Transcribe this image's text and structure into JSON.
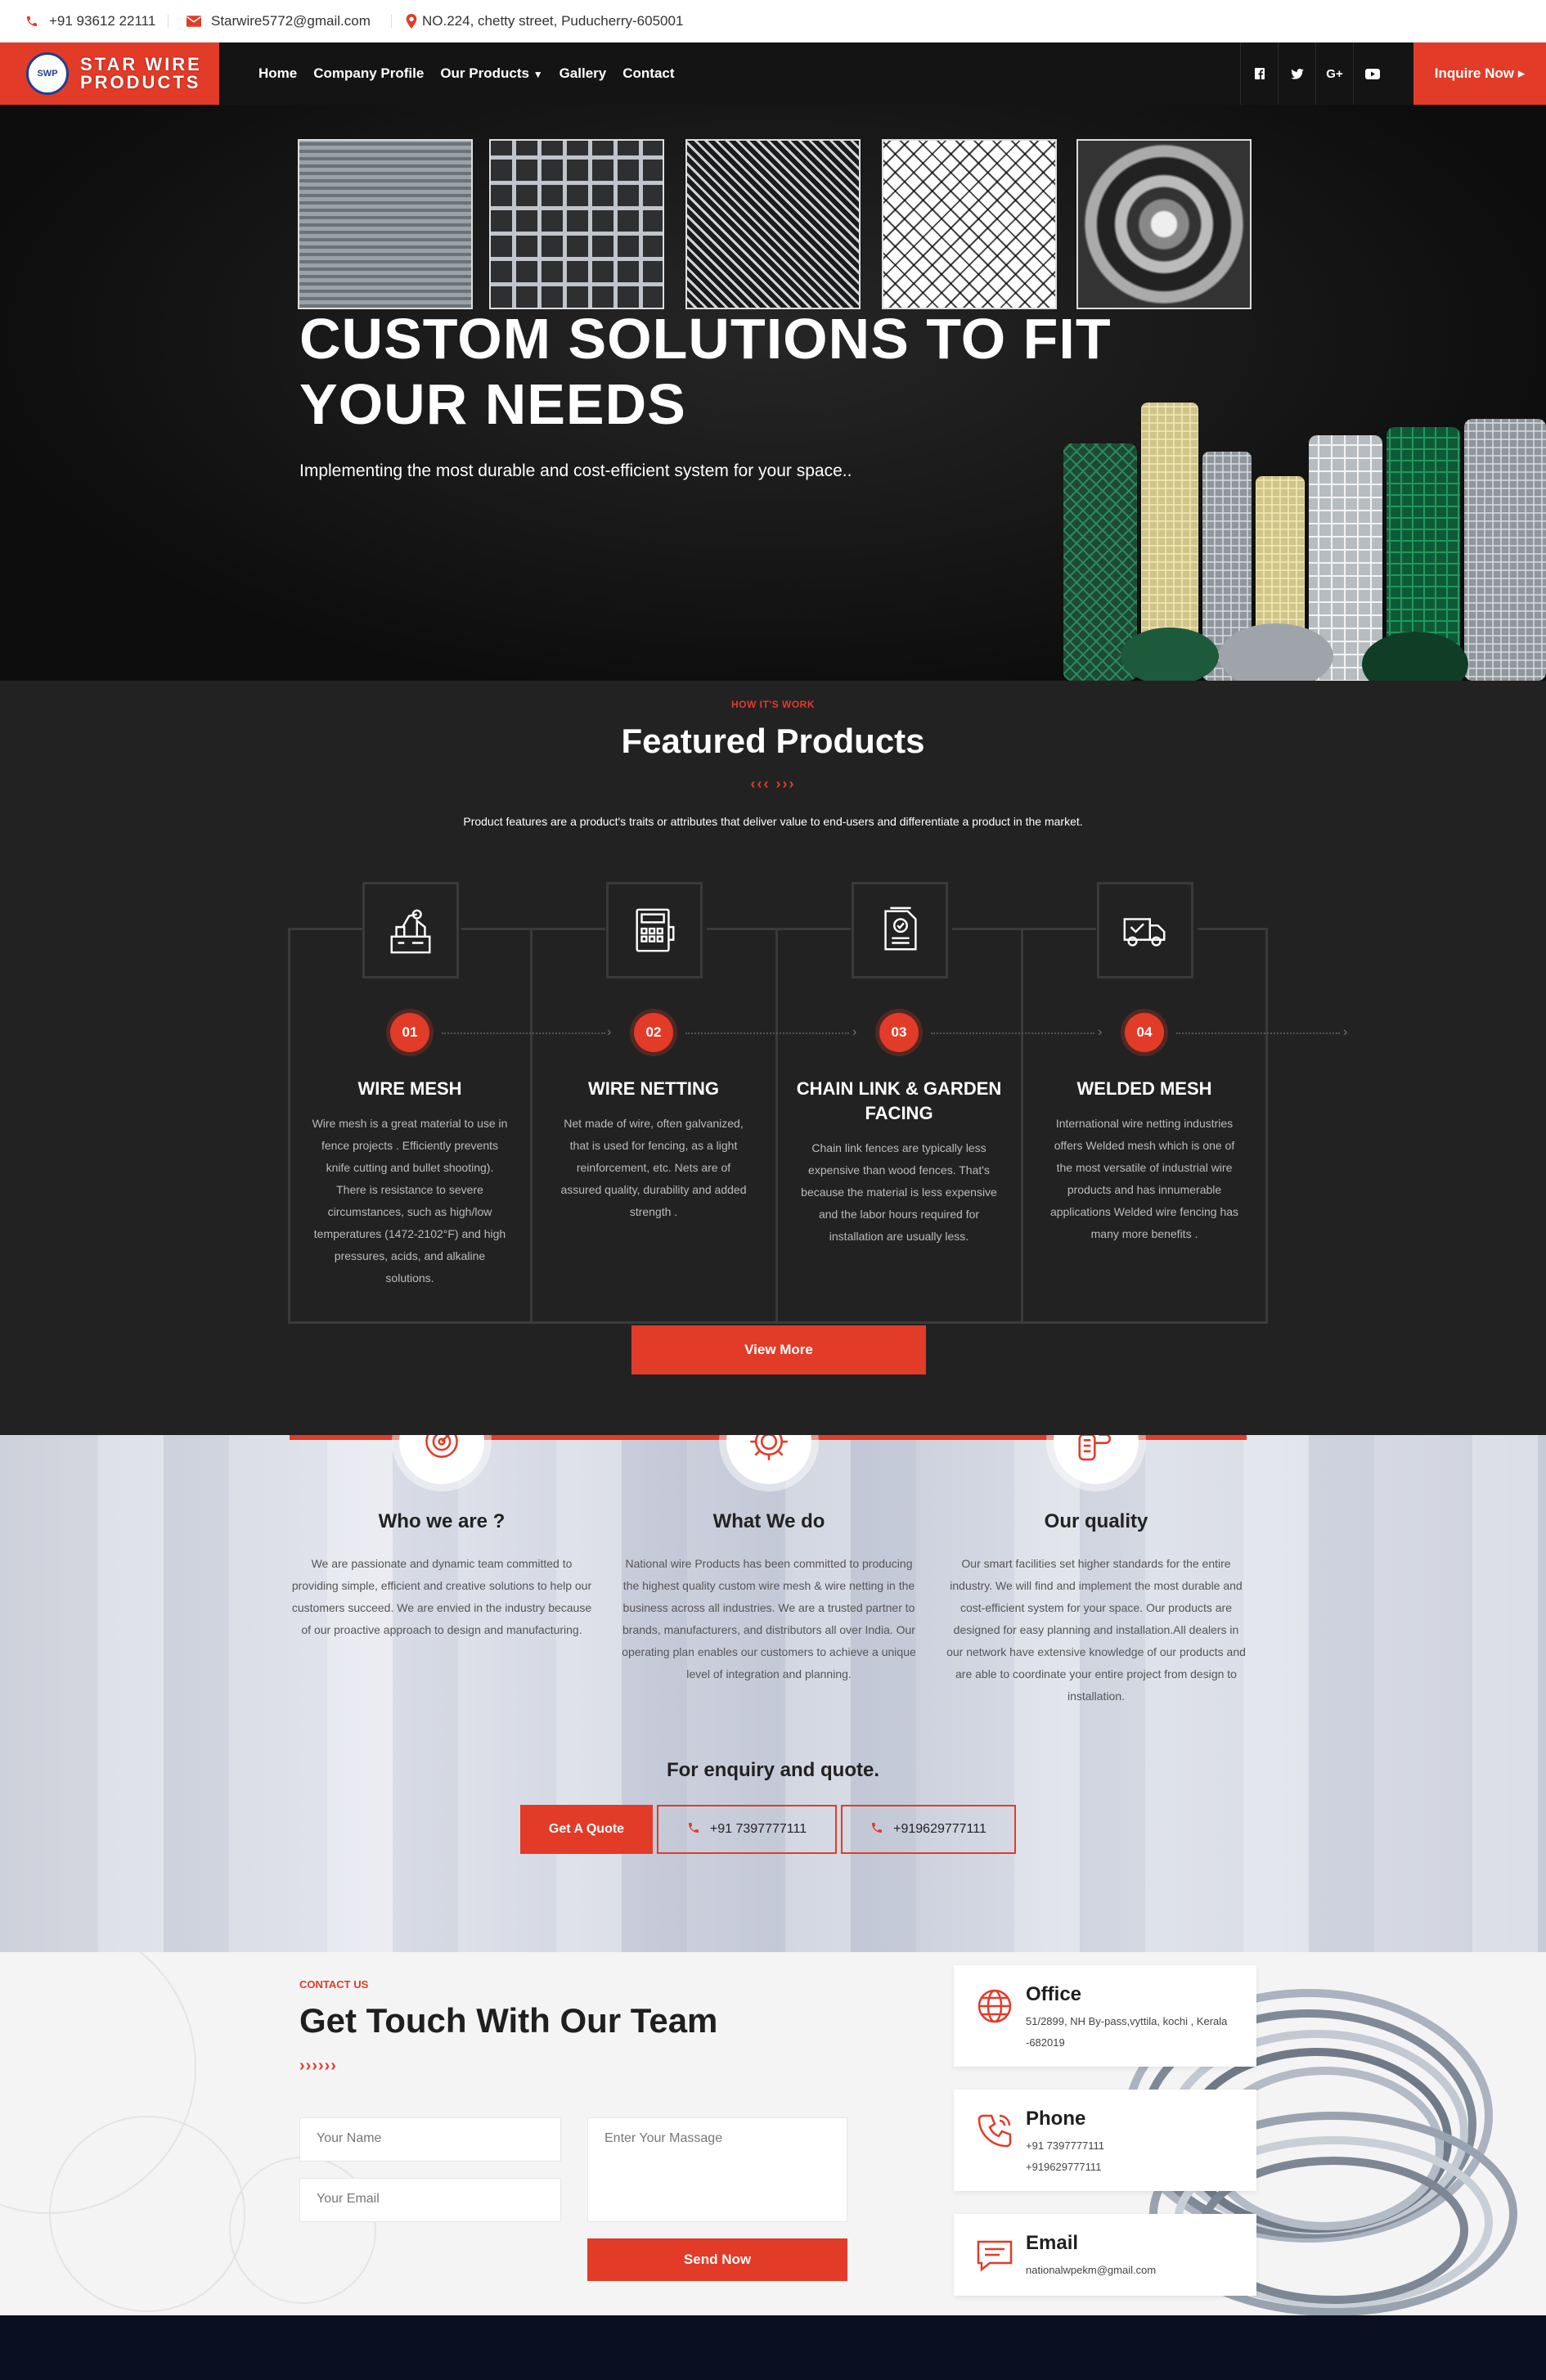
{
  "topbar": {
    "phone": "+91 93612 22111",
    "email": "Starwire5772@gmail.com",
    "address": "NO.224, chetty street, Puducherry-605001"
  },
  "brand": {
    "badge": "SWP",
    "line1": "STAR WIRE",
    "line2": "PRODUCTS",
    "accent": "#e23b28",
    "navy": "#1d3f8f"
  },
  "nav": {
    "items": [
      "Home",
      "Company Profile",
      "Our Products",
      "Gallery",
      "Contact"
    ],
    "products_caret": "▼",
    "socials": [
      "f",
      "t",
      "G+",
      "yt"
    ],
    "inquire": "Inquire Now ▸"
  },
  "hero": {
    "title_line1": "CUSTOM SOLUTIONS TO FIT",
    "title_line2": "YOUR NEEDS",
    "subtitle": "Implementing the most durable and cost-efficient system for your space.."
  },
  "featured": {
    "eyebrow": "HOW IT'S WORK",
    "title": "Featured Products",
    "chevrons": "‹‹‹ ›››",
    "description": "Product features are a product's traits or attributes that deliver value to end-users and differentiate a product in the market.",
    "cards": [
      {
        "icon": "factory-robot-icon",
        "number": "01",
        "title": "WIRE MESH",
        "text": "Wire mesh is a great material to use in fence projects . Efficiently prevents knife cutting and bullet shooting). There is resistance to severe circumstances, such as high/low temperatures (1472-2102°F) and high pressures, acids, and alkaline solutions."
      },
      {
        "icon": "machine-panel-icon",
        "number": "02",
        "title": "WIRE NETTING",
        "text": "Net made of wire, often galvanized, that is used for fencing, as a light reinforcement, etc. Nets are of assured quality, durability and added strength ."
      },
      {
        "icon": "document-check-icon",
        "number": "03",
        "title": "CHAIN LINK & GARDEN FACING",
        "text": "Chain link fences are typically less expensive than wood fences. That's because the material is less expensive and the labor hours required for installation are usually less."
      },
      {
        "icon": "delivery-truck-icon",
        "number": "04",
        "title": "WELDED MESH",
        "text": "International wire netting industries offers Welded mesh which is one of the most versatile of industrial wire products and has innumerable applications Welded wire fencing has many more benefits ."
      }
    ],
    "view_more": "View More"
  },
  "about": {
    "items": [
      {
        "icon": "target-icon",
        "title": "Who we are ?",
        "text": "We are passionate and dynamic team committed to providing simple, efficient and creative solutions to help our customers succeed. We are envied in the industry because of our proactive approach to design and manufacturing."
      },
      {
        "icon": "gear-icon",
        "title": "What We do",
        "text": "National wire Products has been committed to producing the highest quality custom wire mesh & wire netting in the business across all industries. We are a trusted partner to brands, manufacturers, and distributors all over India. Our operating plan enables our customers to achieve a unique level of integration and planning."
      },
      {
        "icon": "quality-hand-icon",
        "title": "Our quality",
        "text": "Our smart facilities set higher standards for the entire industry. We will find and implement the most durable and cost-efficient system for your space. Our products are designed for easy planning and installation.All dealers in our network have extensive knowledge of our products and are able to coordinate your entire project from design to installation."
      }
    ],
    "enquiry": "For enquiry and quote.",
    "quote_button": "Get A Quote",
    "phone1": "+91 7397777111",
    "phone2": "+919629777111"
  },
  "contact": {
    "eyebrow": "CONTACT US",
    "title": "Get Touch With Our Team",
    "chevrons": "››››››",
    "name_placeholder": "Your Name",
    "email_placeholder": "Your Email",
    "message_placeholder": "Enter Your Massage",
    "send": "Send Now",
    "office": {
      "title": "Office",
      "line1": "51/2899, NH By-pass,vyttila, kochi , Kerala",
      "line2": "-682019"
    },
    "phone": {
      "title": "Phone",
      "line1": "+91 7397777111",
      "line2": "+919629777111"
    },
    "email": {
      "title": "Email",
      "line1": "nationalwpekm@gmail.com"
    }
  }
}
